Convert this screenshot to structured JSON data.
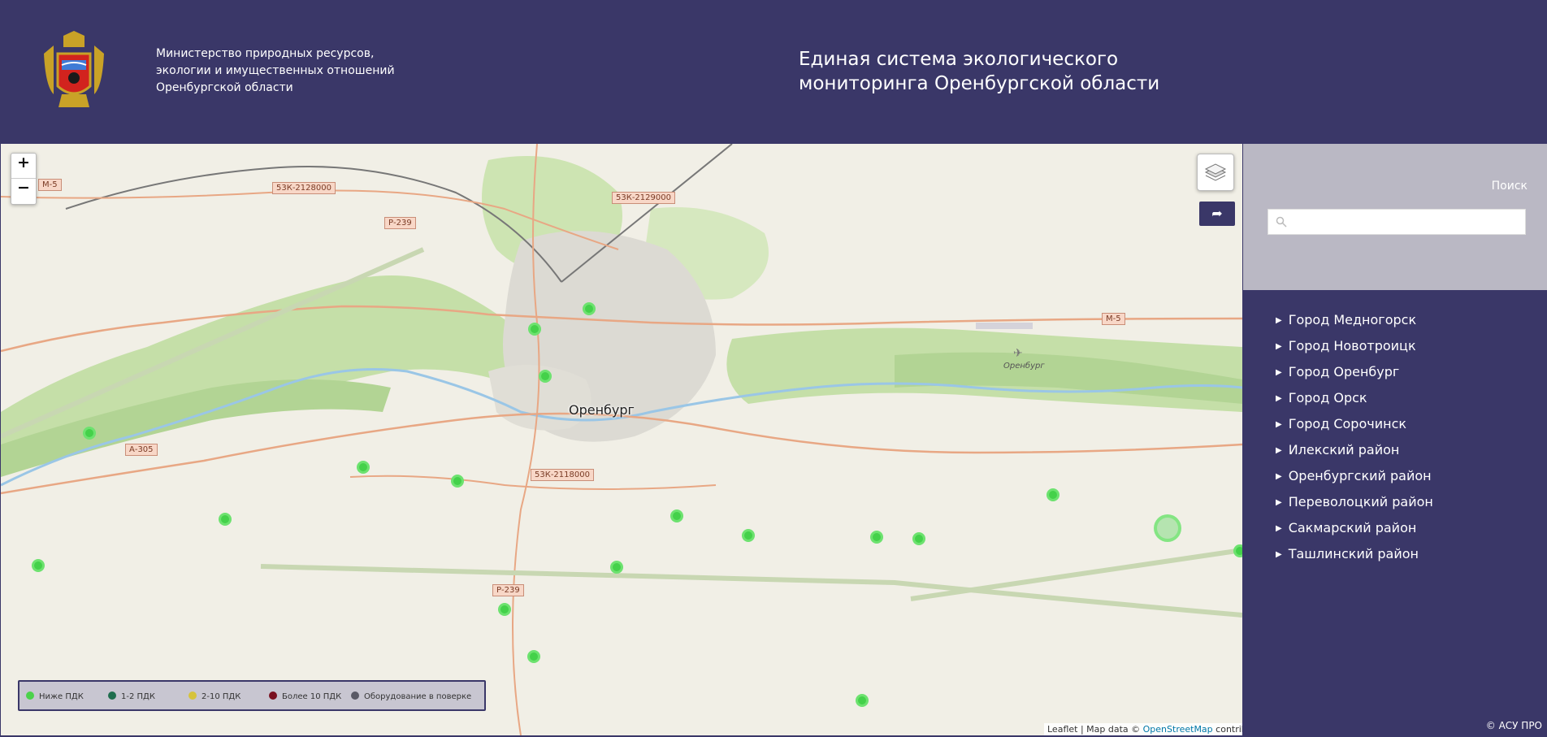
{
  "header": {
    "ministry_lines": [
      "Министерство природных ресурсов,",
      "экологии и имущественных отношений",
      "Оренбургской области"
    ],
    "title_lines": [
      "Единая система экологического",
      "мониторинга Оренбургской области"
    ],
    "coat_of_arms": "coat-of-arms-icon"
  },
  "map": {
    "city_label": "Оренбург",
    "airport_label": "Оренбург",
    "road_labels": [
      "М-5",
      "53К-2128000",
      "Р-239",
      "53К-2129000",
      "М-5",
      "А-305",
      "53К-2118000",
      "Р-239"
    ],
    "zoom_in": "+",
    "zoom_out": "−",
    "attribution": {
      "leaflet": "Leaflet",
      "sep": " | Map data © ",
      "osm": "OpenStreetMap",
      "contrib": " contributors"
    },
    "station_color": "#44d14a"
  },
  "legend": [
    {
      "label": "Ниже ПДК",
      "color": "#4bd24b"
    },
    {
      "label": "1-2 ПДК",
      "color": "#1f6e4e"
    },
    {
      "label": "2-10 ПДК",
      "color": "#d6c33b"
    },
    {
      "label": "Более 10 ПДК",
      "color": "#7a1020"
    },
    {
      "label": "Оборудование в поверке",
      "color": "#5a5a66"
    }
  ],
  "sidebar": {
    "search_label": "Поиск",
    "search_value": "",
    "districts": [
      "Город Медногорск",
      "Город Новотроицк",
      "Город Оренбург",
      "Город Орск",
      "Город Сорочинск",
      "Илекский район",
      "Оренбургский район",
      "Переволоцкий район",
      "Сакмарский район",
      "Ташлинский район"
    ]
  },
  "footer": {
    "copyright": "© АСУ ПРО"
  },
  "colors": {
    "brand": "#3a3768",
    "sidebar_top": "#bab8c4"
  }
}
